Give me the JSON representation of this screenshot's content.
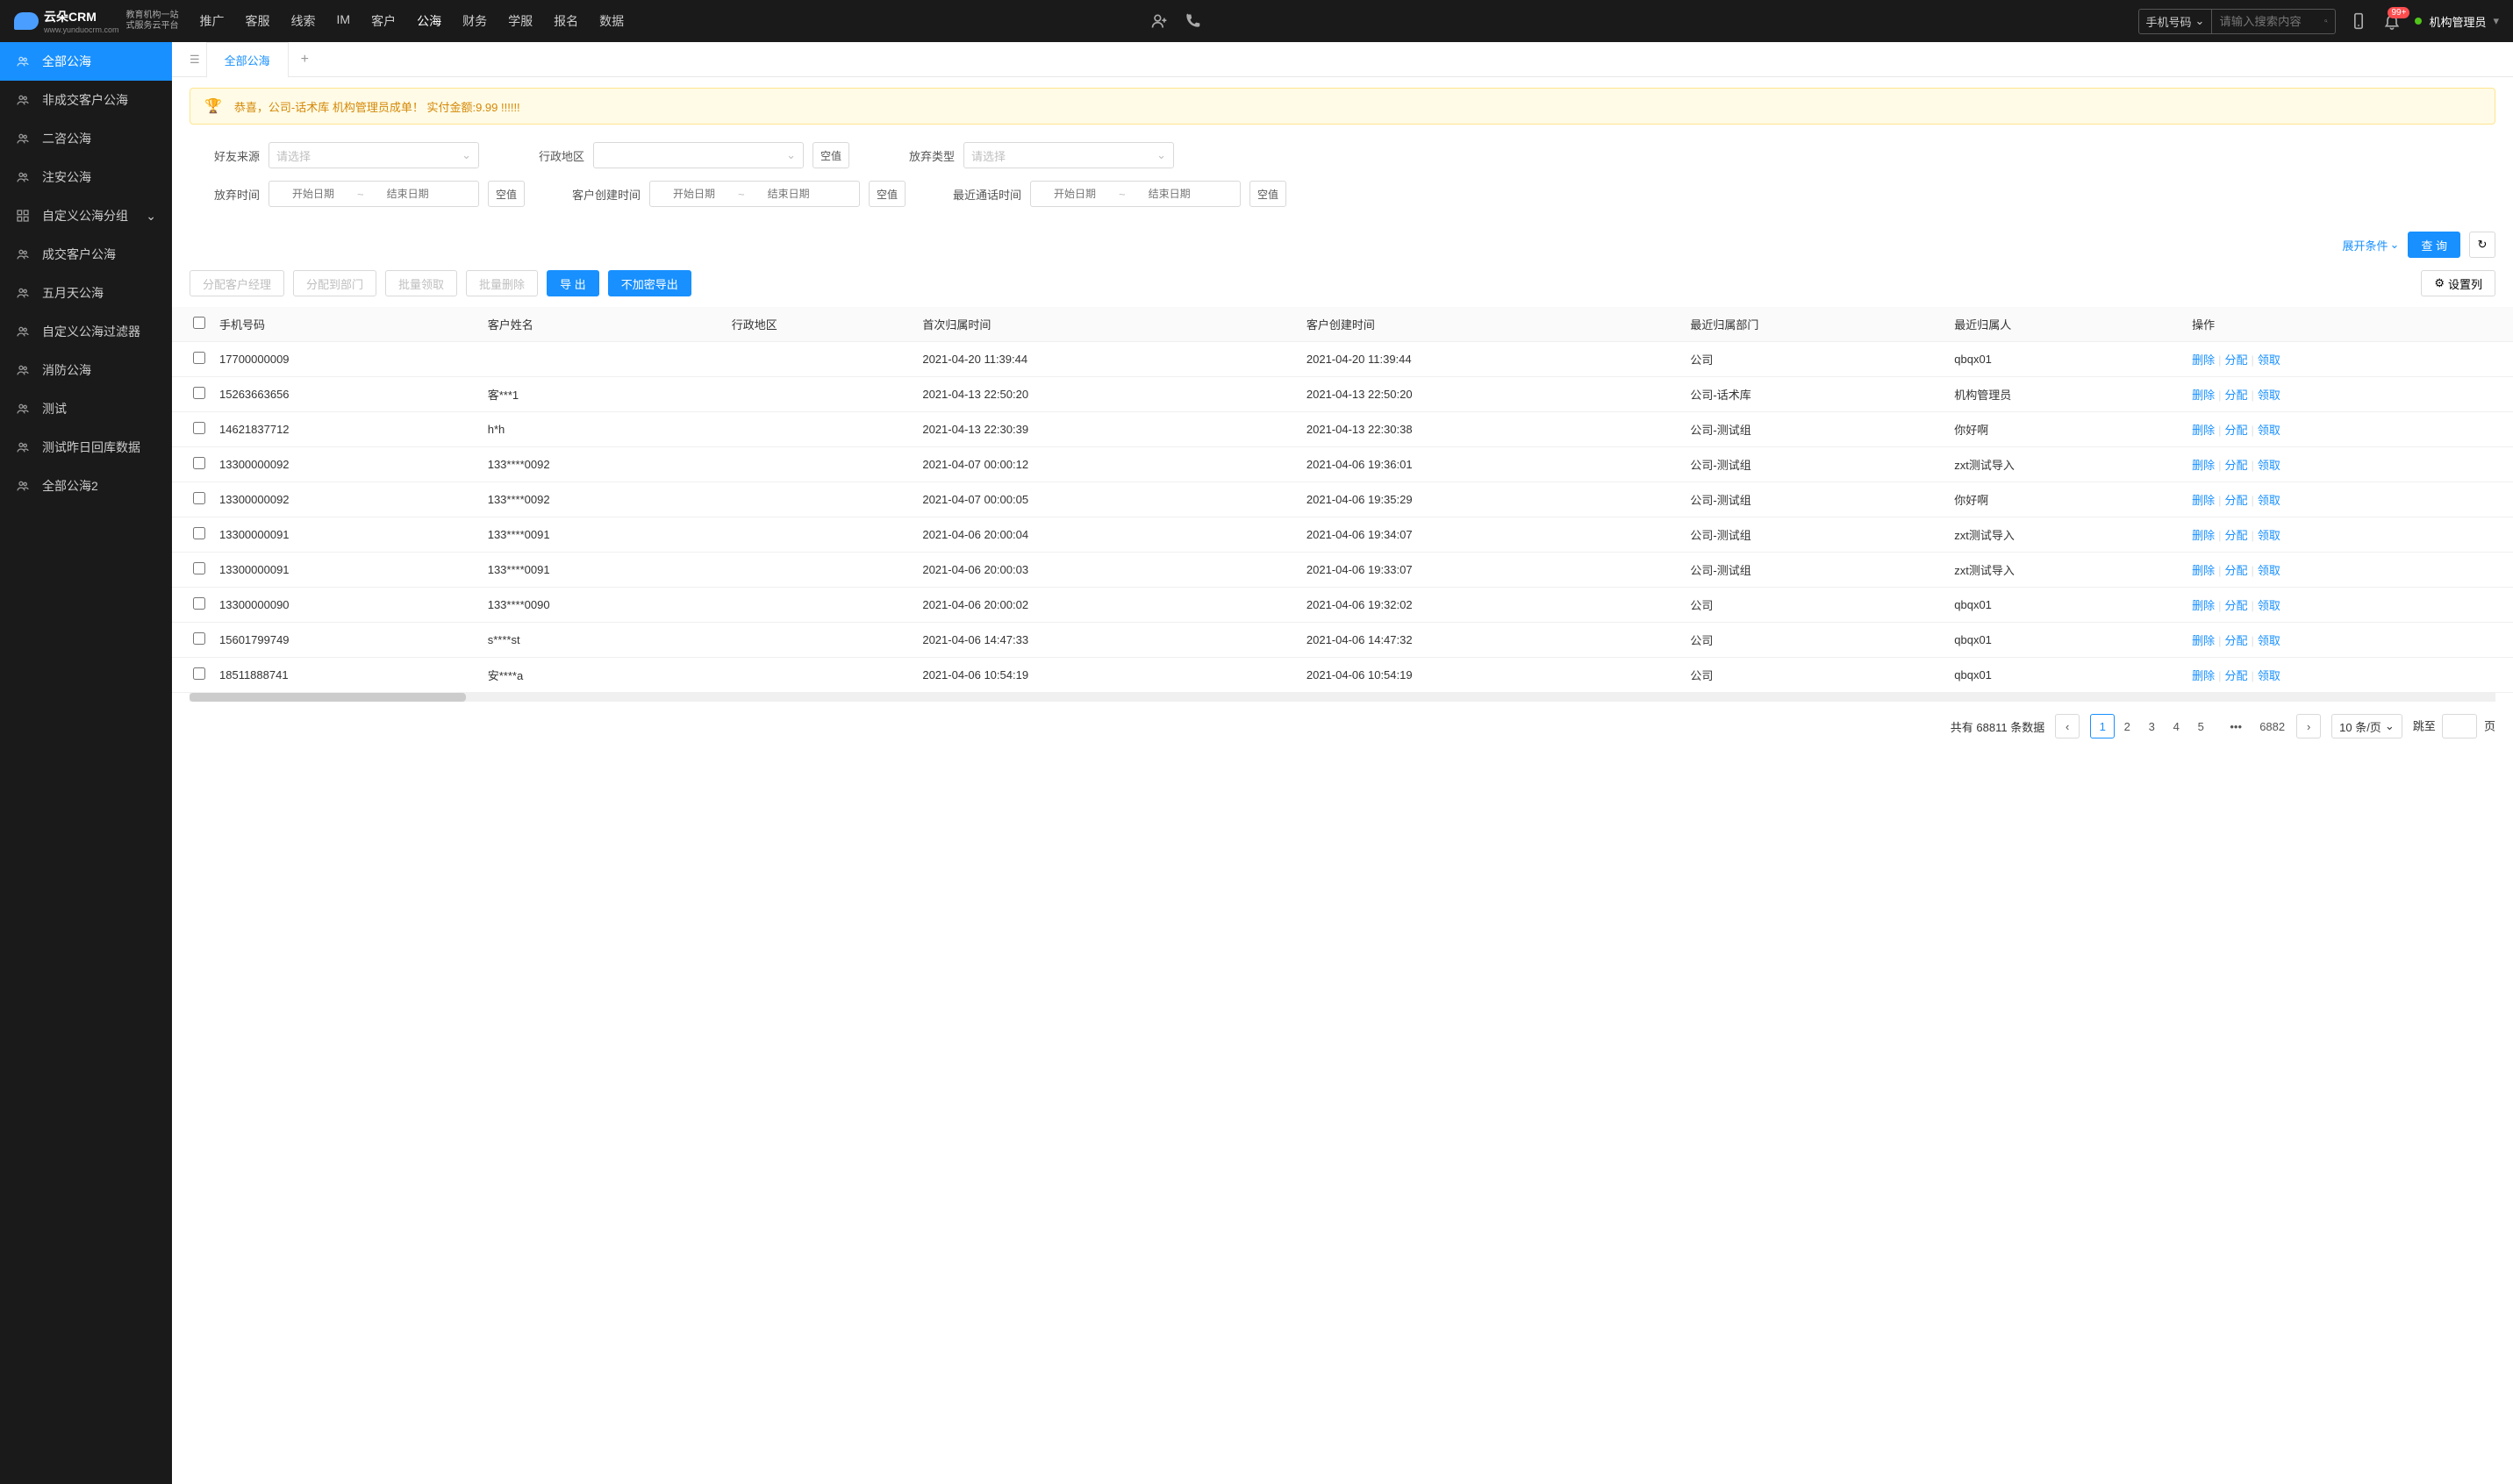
{
  "header": {
    "logo": "云朵CRM",
    "logo_url": "www.yunduocrm.com",
    "logo_sub1": "教育机构一站",
    "logo_sub2": "式服务云平台",
    "nav": [
      "推广",
      "客服",
      "线索",
      "IM",
      "客户",
      "公海",
      "财务",
      "学服",
      "报名",
      "数据"
    ],
    "nav_active": 5,
    "search_type": "手机号码",
    "search_placeholder": "请输入搜索内容",
    "notif_badge": "99+",
    "user": "机构管理员"
  },
  "sidebar": [
    "全部公海",
    "非成交客户公海",
    "二咨公海",
    "注安公海",
    "自定义公海分组",
    "成交客户公海",
    "五月天公海",
    "自定义公海过滤器",
    "消防公海",
    "测试",
    "测试昨日回库数据",
    "全部公海2"
  ],
  "sidebar_active": 0,
  "sidebar_expandable": 4,
  "tab": "全部公海",
  "banner": "恭喜，公司-话术库  机构管理员成单！  实付金额:9.99 !!!!!!",
  "filters": {
    "friend_source": "好友来源",
    "admin_region": "行政地区",
    "abandon_type": "放弃类型",
    "abandon_time": "放弃时间",
    "create_time": "客户创建时间",
    "last_call": "最近通话时间",
    "placeholder_select": "请选择",
    "placeholder_start": "开始日期",
    "placeholder_end": "结束日期",
    "null_btn": "空值",
    "expand": "展开条件",
    "query": "查 询"
  },
  "toolbar": {
    "assign_mgr": "分配客户经理",
    "assign_dept": "分配到部门",
    "batch_claim": "批量领取",
    "batch_delete": "批量删除",
    "export": "导 出",
    "export_plain": "不加密导出",
    "set_columns": "设置列"
  },
  "columns": [
    "手机号码",
    "客户姓名",
    "行政地区",
    "首次归属时间",
    "客户创建时间",
    "最近归属部门",
    "最近归属人",
    "操作"
  ],
  "actions": {
    "delete": "删除",
    "assign": "分配",
    "claim": "领取"
  },
  "rows": [
    {
      "phone": "17700000009",
      "name": "",
      "region": "",
      "first": "2021-04-20 11:39:44",
      "created": "2021-04-20 11:39:44",
      "dept": "公司",
      "owner": "qbqx01"
    },
    {
      "phone": "15263663656",
      "name": "客***1",
      "region": "",
      "first": "2021-04-13 22:50:20",
      "created": "2021-04-13 22:50:20",
      "dept": "公司-话术库",
      "owner": "机构管理员"
    },
    {
      "phone": "14621837712",
      "name": "h*h",
      "region": "",
      "first": "2021-04-13 22:30:39",
      "created": "2021-04-13 22:30:38",
      "dept": "公司-测试组",
      "owner": "你好啊"
    },
    {
      "phone": "13300000092",
      "name": "133****0092",
      "region": "",
      "first": "2021-04-07 00:00:12",
      "created": "2021-04-06 19:36:01",
      "dept": "公司-测试组",
      "owner": "zxt测试导入"
    },
    {
      "phone": "13300000092",
      "name": "133****0092",
      "region": "",
      "first": "2021-04-07 00:00:05",
      "created": "2021-04-06 19:35:29",
      "dept": "公司-测试组",
      "owner": "你好啊"
    },
    {
      "phone": "13300000091",
      "name": "133****0091",
      "region": "",
      "first": "2021-04-06 20:00:04",
      "created": "2021-04-06 19:34:07",
      "dept": "公司-测试组",
      "owner": "zxt测试导入"
    },
    {
      "phone": "13300000091",
      "name": "133****0091",
      "region": "",
      "first": "2021-04-06 20:00:03",
      "created": "2021-04-06 19:33:07",
      "dept": "公司-测试组",
      "owner": "zxt测试导入"
    },
    {
      "phone": "13300000090",
      "name": "133****0090",
      "region": "",
      "first": "2021-04-06 20:00:02",
      "created": "2021-04-06 19:32:02",
      "dept": "公司",
      "owner": "qbqx01"
    },
    {
      "phone": "15601799749",
      "name": "s****st",
      "region": "",
      "first": "2021-04-06 14:47:33",
      "created": "2021-04-06 14:47:32",
      "dept": "公司",
      "owner": "qbqx01"
    },
    {
      "phone": "18511888741",
      "name": "安****a",
      "region": "",
      "first": "2021-04-06 10:54:19",
      "created": "2021-04-06 10:54:19",
      "dept": "公司",
      "owner": "qbqx01"
    }
  ],
  "pagination": {
    "total_prefix": "共有",
    "total": "68811",
    "total_suffix": "条数据",
    "pages": [
      "1",
      "2",
      "3",
      "4",
      "5"
    ],
    "last": "6882",
    "size": "10 条/页",
    "jump_prefix": "跳至",
    "jump_suffix": "页"
  }
}
